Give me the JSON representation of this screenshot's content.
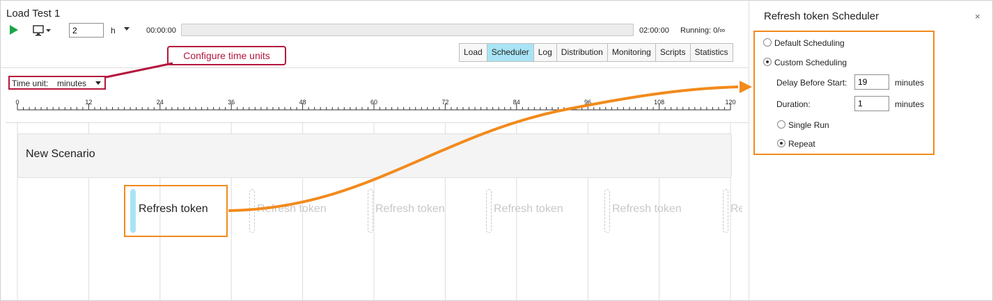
{
  "window": {
    "title": "Load Test 1"
  },
  "toolbar": {
    "duration_value": "2",
    "duration_unit": "h",
    "start_time": "00:00:00",
    "end_time": "02:00:00",
    "running": "Running: 0/∞",
    "progress": 0
  },
  "tabs": [
    "Load",
    "Scheduler",
    "Log",
    "Distribution",
    "Monitoring",
    "Scripts",
    "Statistics"
  ],
  "active_tab": "Scheduler",
  "time_unit": {
    "label": "Time unit:",
    "value": "minutes"
  },
  "callout": {
    "text": "Configure time units"
  },
  "ruler": {
    "ticks": [
      "0",
      "12",
      "24",
      "36",
      "48",
      "60",
      "72",
      "84",
      "96",
      "108",
      "120"
    ]
  },
  "scenario": {
    "name": "New Scenario"
  },
  "task": {
    "label": "Refresh token",
    "ghost_labels": [
      "Refresh token",
      "Refresh token",
      "Refresh token",
      "Refresh token",
      "Re"
    ]
  },
  "panel": {
    "title": "Refresh token Scheduler",
    "close": "×",
    "default_scheduling": "Default Scheduling",
    "custom_scheduling": "Custom Scheduling",
    "delay_label": "Delay Before Start:",
    "delay_value": "19",
    "delay_unit": "minutes",
    "duration_label": "Duration:",
    "duration_value": "1",
    "duration_unit": "minutes",
    "single_run": "Single Run",
    "repeat": "Repeat"
  },
  "colors": {
    "accent_orange": "#f28a1c",
    "callout_red": "#b4163d",
    "active_tab": "#a8e4f5",
    "play_green": "#1aa54a"
  }
}
